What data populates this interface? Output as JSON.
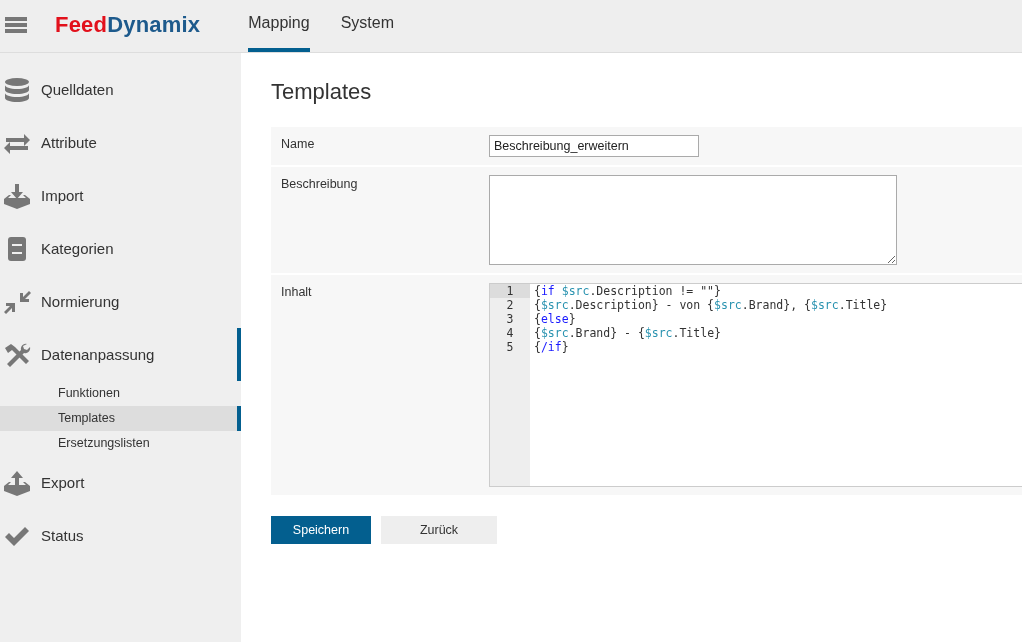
{
  "header": {
    "logo": {
      "part_1": "Feed",
      "part_2": "Dynamix"
    },
    "tabs": [
      {
        "label": "Mapping",
        "selected": true
      },
      {
        "label": "System",
        "selected": false
      }
    ]
  },
  "sidebar": {
    "items": [
      {
        "label": "Quelldaten",
        "kind": "database",
        "selected": false
      },
      {
        "label": "Attribute",
        "kind": "arrows",
        "selected": false
      },
      {
        "label": "Import",
        "kind": "import",
        "selected": false
      },
      {
        "label": "Kategorien",
        "kind": "cabinet",
        "selected": false
      },
      {
        "label": "Normierung",
        "kind": "compress",
        "selected": false
      },
      {
        "label": "Datenanpassung",
        "kind": "tools",
        "selected": true,
        "children": [
          {
            "label": "Funktionen",
            "selected": false
          },
          {
            "label": "Templates",
            "selected": true
          },
          {
            "label": "Ersetzungslisten",
            "selected": false
          }
        ]
      },
      {
        "label": "Export",
        "kind": "export",
        "selected": false
      },
      {
        "label": "Status",
        "kind": "check",
        "selected": false
      }
    ]
  },
  "page": {
    "title": "Templates",
    "form": {
      "name": {
        "label": "Name",
        "value": "Beschreibung_erweitern"
      },
      "description": {
        "label": "Beschreibung"
      },
      "content": {
        "label": "Inhalt",
        "lines": [
          {
            "number": "1",
            "active": true,
            "tokens": [
              {
                "kind": "plain",
                "text": "{"
              },
              {
                "kind": "keyword",
                "text": "if "
              },
              {
                "kind": "variable",
                "text": "$src"
              },
              {
                "kind": "plain",
                "text": ".Description != \"\"}"
              }
            ]
          },
          {
            "number": "2",
            "active": false,
            "tokens": [
              {
                "kind": "plain",
                "text": "{"
              },
              {
                "kind": "variable",
                "text": "$src"
              },
              {
                "kind": "plain",
                "text": ".Description} - von {"
              },
              {
                "kind": "variable",
                "text": "$src"
              },
              {
                "kind": "plain",
                "text": ".Brand}, {"
              },
              {
                "kind": "variable",
                "text": "$src"
              },
              {
                "kind": "plain",
                "text": ".Title}"
              }
            ]
          },
          {
            "number": "3",
            "active": false,
            "tokens": [
              {
                "kind": "plain",
                "text": "{"
              },
              {
                "kind": "keyword",
                "text": "else"
              },
              {
                "kind": "plain",
                "text": "}"
              }
            ]
          },
          {
            "number": "4",
            "active": false,
            "tokens": [
              {
                "kind": "plain",
                "text": "{"
              },
              {
                "kind": "variable",
                "text": "$src"
              },
              {
                "kind": "plain",
                "text": ".Brand} - {"
              },
              {
                "kind": "variable",
                "text": "$src"
              },
              {
                "kind": "plain",
                "text": ".Title}"
              }
            ]
          },
          {
            "number": "5",
            "active": false,
            "tokens": [
              {
                "kind": "plain",
                "text": "{"
              },
              {
                "kind": "keyword",
                "text": "/if"
              },
              {
                "kind": "plain",
                "text": "}"
              }
            ]
          }
        ]
      }
    },
    "buttons": [
      {
        "label": "Speichern",
        "kind": "primary"
      },
      {
        "label": "Zurück",
        "kind": "secondary"
      }
    ]
  }
}
